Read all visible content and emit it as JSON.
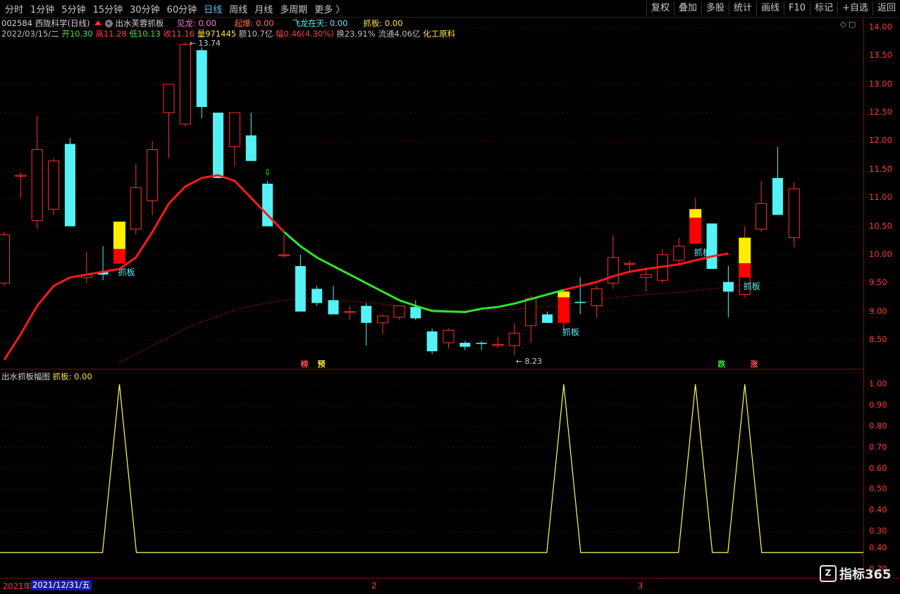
{
  "toolbar": {
    "periods": [
      "分时",
      "1分钟",
      "5分钟",
      "15分钟",
      "30分钟",
      "60分钟",
      "日线",
      "周线",
      "月线",
      "多周期",
      "更多 〉"
    ],
    "active_period": "日线",
    "right_buttons": [
      "复权",
      "叠加",
      "多股",
      "统计",
      "画线",
      "F10",
      "标记",
      "+自选",
      "返回"
    ]
  },
  "stock": {
    "code": "002584",
    "name": "西陇科学",
    "period": "(日线)",
    "indicator": "出水芙蓉抓板",
    "jianlong": "见龙: 0.00",
    "qibao": "起爆: 0.00",
    "feilong": "飞龙在天: 0.00",
    "zhuaban": "抓板: 0.00"
  },
  "quote": {
    "date": "2022/03/15/二",
    "open_label": "开",
    "open": "10.30",
    "high_label": "高",
    "high": "11.28",
    "low_label": "低",
    "low": "10.13",
    "close_label": "收",
    "close": "11.16",
    "vol_label": "量",
    "vol": "971445",
    "amount_label": "额",
    "amount": "10.7亿",
    "change_label": "幅",
    "change": "0.46(4.30%)",
    "turnover_label": "换",
    "turnover": "23.91%",
    "float_label": "流通",
    "float": "4.06亿",
    "sector": "化工原料"
  },
  "sub_indicator": {
    "name": "出水抓板幅图",
    "value": "抓板: 0.00"
  },
  "main_axis": [
    "14.00",
    "13.50",
    "13.00",
    "12.50",
    "12.00",
    "11.50",
    "11.00",
    "10.50",
    "10.00",
    "9.50",
    "9.00",
    "8.50"
  ],
  "sub_axis": [
    "1.00",
    "0.90",
    "0.80",
    "0.70",
    "0.60",
    "0.50",
    "0.40",
    "0.30",
    "0.40",
    "0.20"
  ],
  "bottom_axis": {
    "year": "2021年",
    "cursor_date": "2021/12/31/五",
    "months": [
      "2",
      "3"
    ]
  },
  "markers": {
    "high_label": "13.74",
    "low_label": "8.23",
    "zhuaban_label": "抓板",
    "tags": [
      "榜",
      "预",
      "跌",
      "涨"
    ]
  },
  "watermark": "指标365",
  "colors": {
    "up": "#ff3030",
    "down": "#54f2f5",
    "ma_red": "#ff1a1a",
    "ma_green": "#2ee62e",
    "signal_yellow": "#ffee00",
    "signal_red": "#ff0000",
    "sub_line": "#ffff60"
  },
  "chart_data": {
    "type": "candlestick",
    "price_range": [
      8.0,
      14.1
    ],
    "candles": [
      {
        "o": 9.5,
        "h": 10.4,
        "l": 9.45,
        "c": 10.35
      },
      {
        "o": 11.4,
        "h": 11.45,
        "l": 11.0,
        "c": 11.4
      },
      {
        "o": 10.6,
        "h": 12.45,
        "l": 10.45,
        "c": 11.85
      },
      {
        "o": 10.8,
        "h": 11.7,
        "l": 10.7,
        "c": 11.65
      },
      {
        "o": 11.95,
        "h": 12.05,
        "l": 10.5,
        "c": 10.5
      },
      {
        "o": 9.6,
        "h": 10.05,
        "l": 9.5,
        "c": 9.65
      },
      {
        "o": 9.7,
        "h": 10.15,
        "l": 9.55,
        "c": 9.65
      },
      {
        "o": 9.85,
        "h": 10.58,
        "l": 9.85,
        "c": 10.58
      },
      {
        "o": 10.45,
        "h": 11.6,
        "l": 10.35,
        "c": 11.18
      },
      {
        "o": 10.95,
        "h": 12.0,
        "l": 10.7,
        "c": 11.85
      },
      {
        "o": 12.5,
        "h": 12.8,
        "l": 11.7,
        "c": 13.0
      },
      {
        "o": 12.3,
        "h": 13.74,
        "l": 12.25,
        "c": 13.7
      },
      {
        "o": 13.6,
        "h": 13.65,
        "l": 12.4,
        "c": 12.6
      },
      {
        "o": 12.5,
        "h": 12.5,
        "l": 11.35,
        "c": 11.35
      },
      {
        "o": 11.9,
        "h": 12.5,
        "l": 11.55,
        "c": 12.5
      },
      {
        "o": 12.1,
        "h": 12.5,
        "l": 11.65,
        "c": 11.65
      },
      {
        "o": 11.25,
        "h": 11.3,
        "l": 10.5,
        "c": 10.5
      },
      {
        "o": 10.0,
        "h": 10.35,
        "l": 9.95,
        "c": 10.0
      },
      {
        "o": 9.8,
        "h": 10.0,
        "l": 9.0,
        "c": 9.0
      },
      {
        "o": 9.4,
        "h": 9.45,
        "l": 9.1,
        "c": 9.15
      },
      {
        "o": 9.2,
        "h": 9.45,
        "l": 8.95,
        "c": 8.95
      },
      {
        "o": 9.0,
        "h": 9.1,
        "l": 8.85,
        "c": 9.0
      },
      {
        "o": 9.1,
        "h": 9.15,
        "l": 8.4,
        "c": 8.8
      },
      {
        "o": 8.8,
        "h": 8.95,
        "l": 8.6,
        "c": 8.92
      },
      {
        "o": 8.9,
        "h": 9.1,
        "l": 8.85,
        "c": 9.1
      },
      {
        "o": 9.08,
        "h": 9.2,
        "l": 8.85,
        "c": 8.88
      },
      {
        "o": 8.65,
        "h": 8.7,
        "l": 8.25,
        "c": 8.3
      },
      {
        "o": 8.45,
        "h": 8.7,
        "l": 8.35,
        "c": 8.67
      },
      {
        "o": 8.45,
        "h": 8.48,
        "l": 8.32,
        "c": 8.38
      },
      {
        "o": 8.45,
        "h": 8.48,
        "l": 8.32,
        "c": 8.43
      },
      {
        "o": 8.4,
        "h": 8.55,
        "l": 8.36,
        "c": 8.42
      },
      {
        "o": 8.4,
        "h": 8.8,
        "l": 8.23,
        "c": 8.62
      },
      {
        "o": 8.75,
        "h": 9.28,
        "l": 8.45,
        "c": 9.23
      },
      {
        "o": 8.95,
        "h": 9.0,
        "l": 8.8,
        "c": 8.8
      },
      {
        "o": 8.85,
        "h": 9.4,
        "l": 8.65,
        "c": 9.35
      },
      {
        "o": 9.17,
        "h": 9.6,
        "l": 8.95,
        "c": 9.15
      },
      {
        "o": 9.1,
        "h": 9.45,
        "l": 8.9,
        "c": 9.4
      },
      {
        "o": 9.5,
        "h": 10.35,
        "l": 9.4,
        "c": 9.95
      },
      {
        "o": 9.85,
        "h": 9.9,
        "l": 9.7,
        "c": 9.85
      },
      {
        "o": 9.6,
        "h": 9.75,
        "l": 9.35,
        "c": 9.65
      },
      {
        "o": 9.55,
        "h": 10.1,
        "l": 9.5,
        "c": 10.0
      },
      {
        "o": 9.9,
        "h": 10.3,
        "l": 9.85,
        "c": 10.15
      },
      {
        "o": 10.2,
        "h": 11.0,
        "l": 10.2,
        "c": 10.8
      },
      {
        "o": 10.55,
        "h": 10.55,
        "l": 9.75,
        "c": 9.75
      },
      {
        "o": 9.52,
        "h": 9.8,
        "l": 8.9,
        "c": 9.35
      },
      {
        "o": 9.3,
        "h": 10.5,
        "l": 9.25,
        "c": 9.85
      },
      {
        "o": 10.45,
        "h": 11.3,
        "l": 10.4,
        "c": 10.9
      },
      {
        "o": 11.35,
        "h": 11.9,
        "l": 10.7,
        "c": 10.7
      },
      {
        "o": 10.3,
        "h": 11.28,
        "l": 10.13,
        "c": 11.16
      }
    ],
    "ma_main": [
      8.15,
      8.6,
      9.1,
      9.45,
      9.6,
      9.65,
      9.7,
      9.75,
      9.95,
      10.4,
      10.9,
      11.2,
      11.35,
      11.4,
      11.3,
      11.0,
      10.7,
      10.4,
      10.15,
      9.95,
      9.8,
      9.65,
      9.5,
      9.35,
      9.2,
      9.1,
      9.01,
      9.0,
      8.99,
      9.05,
      9.08,
      9.14,
      9.22,
      9.3,
      9.38,
      9.45,
      9.52,
      9.62,
      9.7,
      9.75,
      9.79,
      9.83,
      9.9,
      9.97,
      10.02
    ],
    "ma_green_range": [
      17,
      34
    ],
    "ma_slow": [
      8.1,
      8.25,
      8.4,
      8.55,
      8.7,
      8.82,
      8.92,
      9.02,
      9.1,
      9.15,
      9.2,
      9.22,
      9.21,
      9.2,
      9.18,
      9.16,
      9.13,
      9.1,
      9.07,
      9.04,
      9.02,
      9.01,
      9.01,
      9.02,
      9.04,
      9.06,
      9.09,
      9.12,
      9.16,
      9.2,
      9.24,
      9.27,
      9.3,
      9.32,
      9.34,
      9.37,
      9.4,
      9.44,
      9.46
    ],
    "signals": [
      {
        "index": 7,
        "top": 10.58,
        "mid": 10.1,
        "bottom": 9.85
      },
      {
        "index": 34,
        "top": 9.35,
        "mid": 9.25,
        "bottom": 8.8
      },
      {
        "index": 42,
        "top": 10.8,
        "mid": 10.65,
        "bottom": 10.2
      },
      {
        "index": 45,
        "top": 10.3,
        "mid": 9.85,
        "bottom": 9.6
      }
    ],
    "sub_series": {
      "peaks": [
        7,
        34,
        42,
        45
      ],
      "range": [
        0.2,
        1.0
      ]
    }
  }
}
